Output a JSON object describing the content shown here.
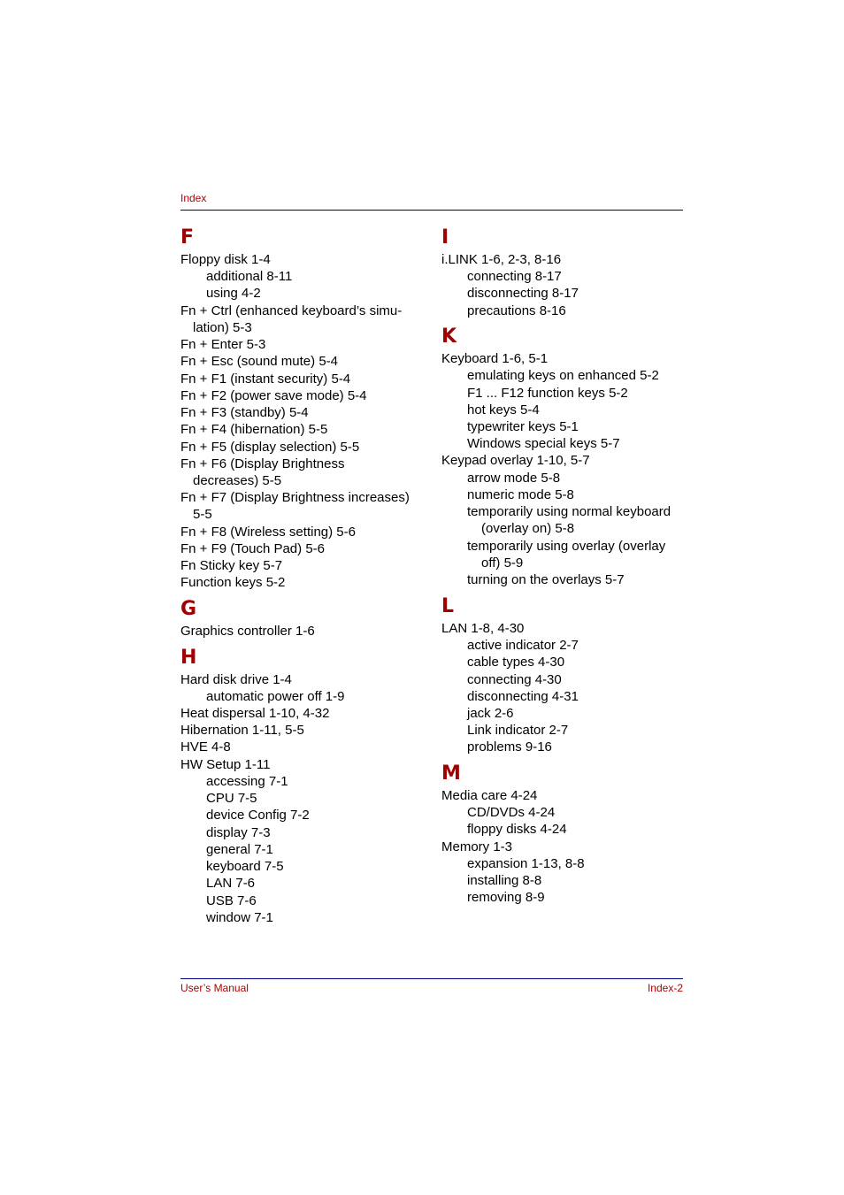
{
  "header": {
    "title": "Index"
  },
  "footer": {
    "left": "User’s Manual",
    "right": "Index-2"
  },
  "left_column": {
    "F": {
      "letter": "F",
      "lines": [
        "Floppy disk 1-4",
        "additional 8-11",
        "using 4-2",
        "Fn + Ctrl (enhanced keyboard’s simu-",
        "lation) 5-3",
        "Fn + Enter 5-3",
        "Fn + Esc (sound mute) 5-4",
        "Fn + F1 (instant security) 5-4",
        "Fn + F2 (power save mode) 5-4",
        "Fn + F3 (standby) 5-4",
        "Fn + F4 (hibernation) 5-5",
        "Fn + F5 (display selection) 5-5",
        "Fn + F6 (Display Brightness",
        "decreases) 5-5",
        "Fn + F7 (Display Brightness increases)",
        "5-5",
        "Fn + F8 (Wireless setting) 5-6",
        "Fn + F9 (Touch Pad) 5-6",
        "Fn Sticky key 5-7",
        "Function keys 5-2"
      ]
    },
    "G": {
      "letter": "G",
      "lines": [
        "Graphics controller 1-6"
      ]
    },
    "H": {
      "letter": "H",
      "lines": [
        "Hard disk drive 1-4",
        "automatic power off 1-9",
        "Heat dispersal 1-10, 4-32",
        "Hibernation 1-11, 5-5",
        "HVE 4-8",
        "HW Setup 1-11",
        "accessing 7-1",
        "CPU 7-5",
        "device Config 7-2",
        "display 7-3",
        "general 7-1",
        "keyboard 7-5",
        "LAN 7-6",
        "USB 7-6",
        "window 7-1"
      ]
    }
  },
  "right_column": {
    "I": {
      "letter": "I",
      "lines": [
        "i.LINK 1-6, 2-3, 8-16",
        "connecting 8-17",
        "disconnecting 8-17",
        "precautions 8-16"
      ]
    },
    "K": {
      "letter": "K",
      "lines": [
        "Keyboard 1-6, 5-1",
        "emulating keys on enhanced 5-2",
        "F1 ... F12 function keys 5-2",
        "hot keys 5-4",
        "typewriter keys 5-1",
        "Windows special keys 5-7",
        "Keypad overlay 1-10, 5-7",
        "arrow mode 5-8",
        "numeric mode 5-8",
        "temporarily using normal keyboard",
        "(overlay on) 5-8",
        "temporarily using overlay (overlay",
        "off) 5-9",
        "turning on the overlays 5-7"
      ]
    },
    "L": {
      "letter": "L",
      "lines": [
        "LAN 1-8, 4-30",
        "active indicator 2-7",
        "cable types 4-30",
        "connecting 4-30",
        "disconnecting 4-31",
        "jack 2-6",
        "Link indicator 2-7",
        "problems 9-16"
      ]
    },
    "M": {
      "letter": "M",
      "lines": [
        "Media care 4-24",
        "CD/DVDs 4-24",
        "floppy disks 4-24",
        "Memory 1-3",
        "expansion 1-13, 8-8",
        "installing 8-8",
        "removing 8-9"
      ]
    }
  }
}
